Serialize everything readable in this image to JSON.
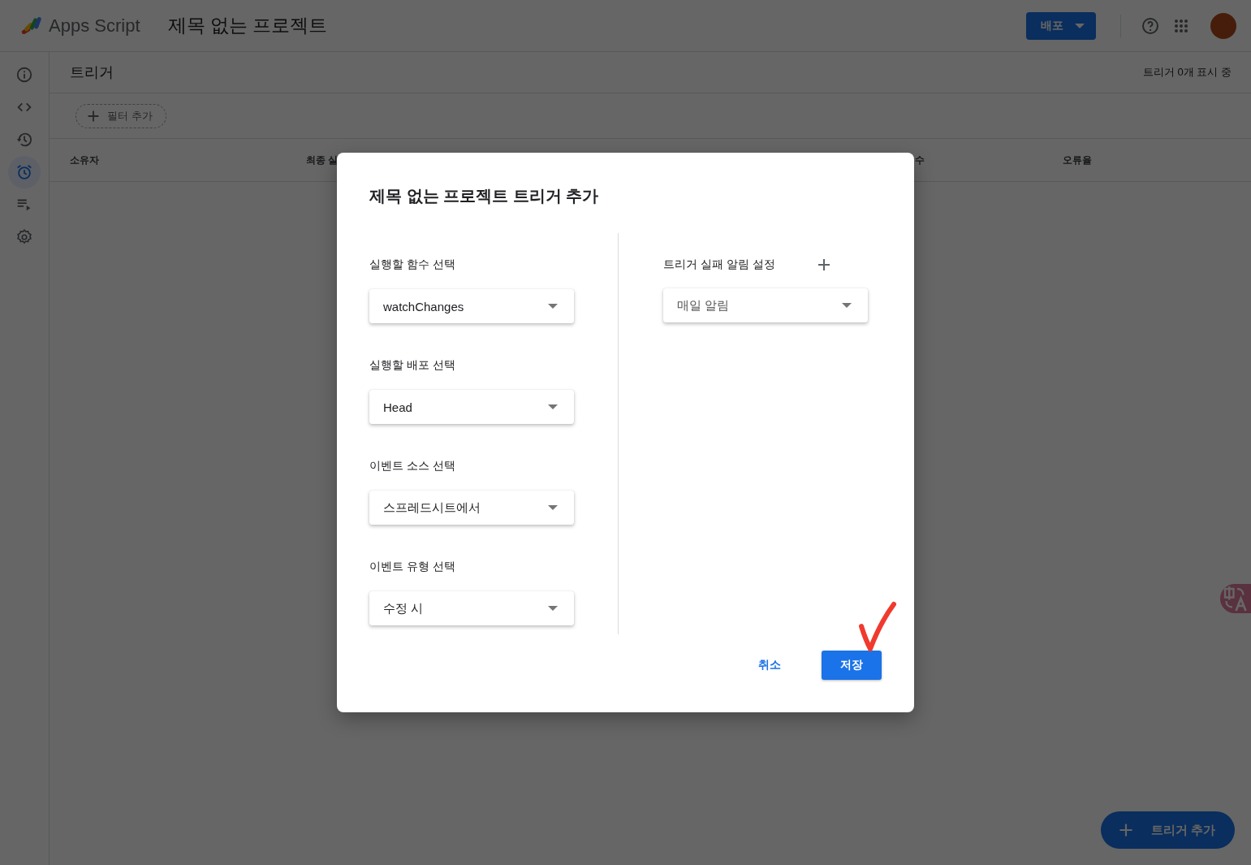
{
  "app": {
    "name": "Apps Script",
    "project_title": "제목 없는 프로젝트"
  },
  "deploy_button": {
    "label": "배포"
  },
  "sidebar": {
    "items": [
      {
        "kind": "info",
        "selected": false
      },
      {
        "kind": "code",
        "selected": false
      },
      {
        "kind": "history",
        "selected": false
      },
      {
        "kind": "alarm",
        "selected": true
      },
      {
        "kind": "executions",
        "selected": false
      },
      {
        "kind": "settings",
        "selected": false
      }
    ]
  },
  "page": {
    "title": "트리거",
    "count": "트리거 0개 표시 중",
    "filter_chip": "필터 추가"
  },
  "table": {
    "columns": [
      "소유자",
      "최종 실",
      "수",
      "오류율"
    ]
  },
  "dialog": {
    "title": "제목 없는 프로젝트 트리거 추가",
    "fields": [
      {
        "label": "실행할 함수 선택",
        "value": "watchChanges"
      },
      {
        "label": "실행할 배포 선택",
        "value": "Head"
      },
      {
        "label": "이벤트 소스 선택",
        "value": "스프레드시트에서"
      },
      {
        "label": "이벤트 유형 선택",
        "value": "수정 시"
      }
    ],
    "notification": {
      "label": "트리거 실패 알림 설정",
      "value": "매일 알림"
    },
    "buttons": [
      {
        "label": "취소",
        "kind": "text"
      },
      {
        "label": "저장",
        "kind": "primary"
      }
    ],
    "annotation": {
      "kind": "checkmark"
    }
  },
  "fab": {
    "label": "트리거 추가"
  }
}
